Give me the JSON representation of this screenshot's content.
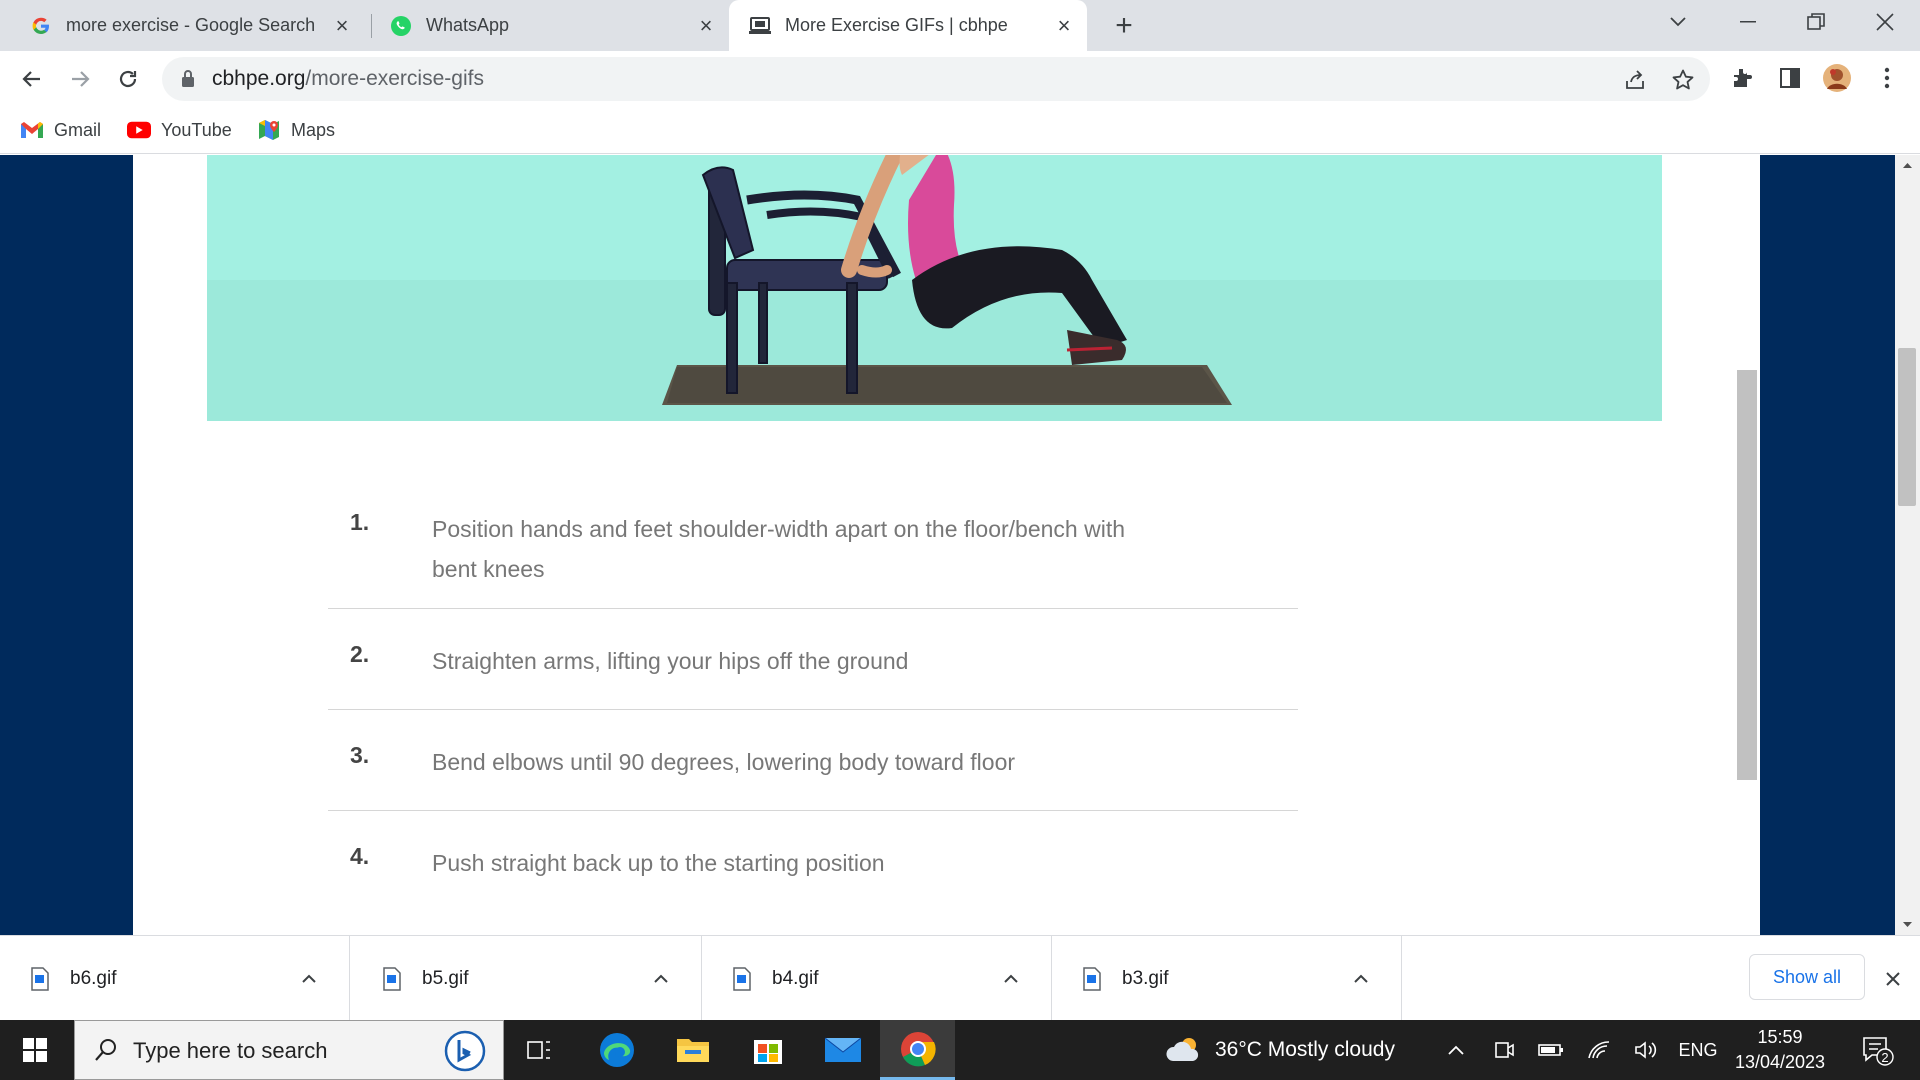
{
  "browser": {
    "tabs": [
      {
        "title": "more exercise - Google Search",
        "icon": "google-icon"
      },
      {
        "title": "WhatsApp",
        "icon": "whatsapp-icon"
      },
      {
        "title": "More Exercise GIFs | cbhpe",
        "icon": "site-icon",
        "active": true
      }
    ],
    "url_domain": "cbhpe.org",
    "url_path": "/more-exercise-gifs",
    "bookmarks": [
      {
        "label": "Gmail",
        "icon": "gmail-icon"
      },
      {
        "label": "YouTube",
        "icon": "youtube-icon"
      },
      {
        "label": "Maps",
        "icon": "maps-icon"
      }
    ]
  },
  "page": {
    "colors": {
      "background": "#002a5c",
      "hero": "#a3f0e2"
    },
    "steps": [
      {
        "num": "1.",
        "text": "Position hands and feet shoulder-width apart on the floor/bench with bent knees"
      },
      {
        "num": "2.",
        "text": "Straighten arms, lifting your hips off the ground"
      },
      {
        "num": "3.",
        "text": "Bend elbows until 90 degrees, lowering body toward floor"
      },
      {
        "num": "4.",
        "text": "Push straight back up to the starting position"
      }
    ]
  },
  "downloads": {
    "items": [
      "b6.gif",
      "b5.gif",
      "b4.gif",
      "b3.gif"
    ],
    "show_all": "Show all"
  },
  "taskbar": {
    "search_placeholder": "Type here to search",
    "weather": "36°C  Mostly cloudy",
    "lang": "ENG",
    "time": "15:59",
    "date": "13/04/2023",
    "notifications": "2"
  }
}
